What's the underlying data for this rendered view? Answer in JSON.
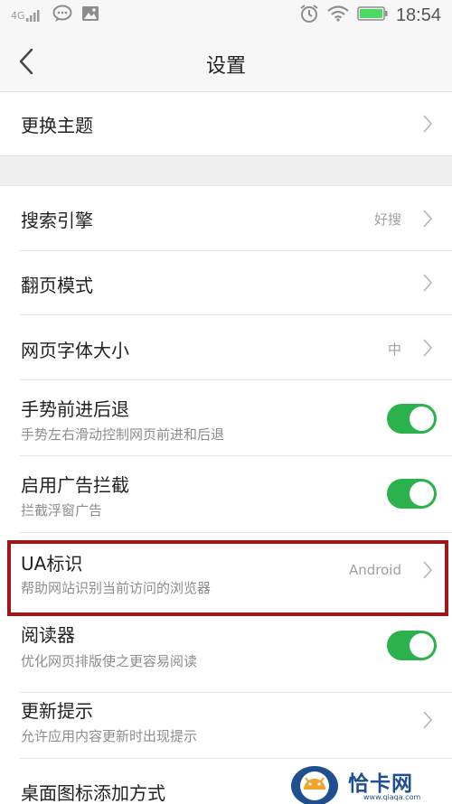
{
  "status_bar": {
    "network": "4G",
    "time": "18:54",
    "icons": [
      "signal-icon",
      "message-icon",
      "image-icon",
      "alarm-icon",
      "wifi-icon",
      "battery-icon"
    ]
  },
  "header": {
    "title": "设置",
    "back_icon": "chevron-left-icon"
  },
  "settings": {
    "theme": {
      "title": "更换主题"
    },
    "search_engine": {
      "title": "搜索引擎",
      "value": "好搜"
    },
    "page_mode": {
      "title": "翻页模式"
    },
    "font_size": {
      "title": "网页字体大小",
      "value": "中"
    },
    "gesture": {
      "title": "手势前进后退",
      "subtitle": "手势左右滑动控制网页前进和后退",
      "enabled": true
    },
    "ad_block": {
      "title": "启用广告拦截",
      "subtitle": "拦截浮窗广告",
      "enabled": true
    },
    "ua": {
      "title": "UA标识",
      "subtitle": "帮助网站识别当前访问的浏览器",
      "value": "Android"
    },
    "reader": {
      "title": "阅读器",
      "subtitle": "优化网页排版使之更容易阅读",
      "enabled": true
    },
    "update_tips": {
      "title": "更新提示",
      "subtitle": "允许应用内容更新时出现提示"
    },
    "desktop_icon": {
      "title": "桌面图标添加方式"
    }
  },
  "colors": {
    "toggle_on": "#2bb24c",
    "highlight": "#a2161a",
    "watermark": "#1f4f8f"
  },
  "watermark": {
    "text": "恰卡网",
    "url": "www.qiaqa.com"
  }
}
